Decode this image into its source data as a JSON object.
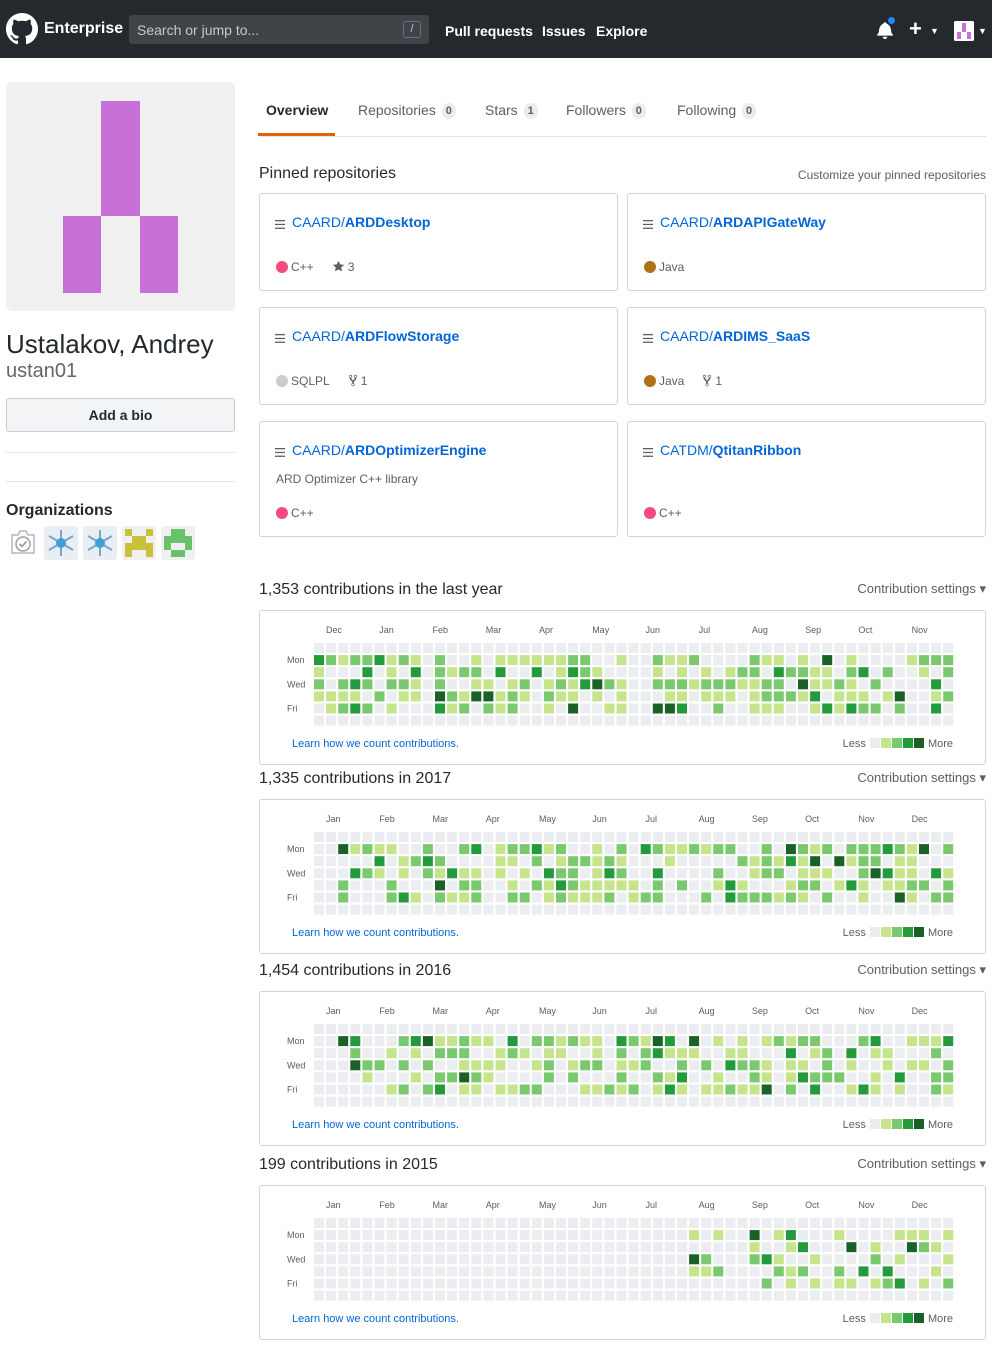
{
  "header": {
    "brand": "Enterprise",
    "search_placeholder": "Search or jump to...",
    "search_key": "/",
    "nav": [
      "Pull requests",
      "Issues",
      "Explore"
    ]
  },
  "profile": {
    "name": "Ustalakov, Andrey",
    "login": "ustan01",
    "bio_button": "Add a bio",
    "orgs_heading": "Organizations"
  },
  "tabs": [
    {
      "label": "Overview",
      "count": ""
    },
    {
      "label": "Repositories",
      "count": "0"
    },
    {
      "label": "Stars",
      "count": "1"
    },
    {
      "label": "Followers",
      "count": "0"
    },
    {
      "label": "Following",
      "count": "0"
    }
  ],
  "pinned": {
    "heading": "Pinned repositories",
    "customize": "Customize your pinned repositories",
    "repos": [
      {
        "owner": "CAARD/",
        "name": "ARDDesktop",
        "desc": "",
        "lang": "C++",
        "lang_color": "#f34b7d",
        "stars": "3",
        "forks": ""
      },
      {
        "owner": "CAARD/",
        "name": "ARDAPIGateWay",
        "desc": "",
        "lang": "Java",
        "lang_color": "#b07219",
        "stars": "",
        "forks": ""
      },
      {
        "owner": "CAARD/",
        "name": "ARDFlowStorage",
        "desc": "",
        "lang": "SQLPL",
        "lang_color": "#cccccc",
        "stars": "",
        "forks": "1"
      },
      {
        "owner": "CAARD/",
        "name": "ARDIMS_SaaS",
        "desc": "",
        "lang": "Java",
        "lang_color": "#b07219",
        "stars": "",
        "forks": "1"
      },
      {
        "owner": "CAARD/",
        "name": "ARDOptimizerEngine",
        "desc": "ARD Optimizer C++ library",
        "lang": "C++",
        "lang_color": "#f34b7d",
        "stars": "",
        "forks": ""
      },
      {
        "owner": "CATDM/",
        "name": "QtitanRibbon",
        "desc": "",
        "lang": "C++",
        "lang_color": "#f34b7d",
        "stars": "",
        "forks": ""
      }
    ]
  },
  "contributions": {
    "settings_label": "Contribution settings",
    "learn": "Learn how we count contributions.",
    "less": "Less",
    "more": "More",
    "days": [
      "Mon",
      "Wed",
      "Fri"
    ],
    "colors": [
      "#ebedf0",
      "#c6e48b",
      "#7bc96f",
      "#239a3b",
      "#196127"
    ],
    "years": [
      {
        "title": "1,353 contributions in the last year",
        "months": [
          "Dec",
          "Jan",
          "Feb",
          "Mar",
          "Apr",
          "May",
          "Jun",
          "Jul",
          "Aug",
          "Sep",
          "Oct",
          "Nov"
        ],
        "first_month_week": 1,
        "active_weeks": [
          [
            0,
            8
          ],
          [
            10,
            25
          ],
          [
            28,
            52
          ]
        ],
        "density": 0.7,
        "seed": 11
      },
      {
        "title": "1,335 contributions in 2017",
        "months": [
          "Jan",
          "Feb",
          "Mar",
          "Apr",
          "May",
          "Jun",
          "Jul",
          "Aug",
          "Sep",
          "Oct",
          "Nov",
          "Dec"
        ],
        "first_month_week": 1,
        "active_weeks": [
          [
            2,
            52
          ]
        ],
        "density": 0.6,
        "seed": 23
      },
      {
        "title": "1,454 contributions in 2016",
        "months": [
          "Jan",
          "Feb",
          "Mar",
          "Apr",
          "May",
          "Jun",
          "Jul",
          "Aug",
          "Sep",
          "Oct",
          "Nov",
          "Dec"
        ],
        "first_month_week": 1,
        "active_weeks": [
          [
            1,
            52
          ]
        ],
        "density": 0.62,
        "seed": 37
      },
      {
        "title": "199 contributions in 2015",
        "months": [
          "Jan",
          "Feb",
          "Mar",
          "Apr",
          "May",
          "Jun",
          "Jul",
          "Aug",
          "Sep",
          "Oct",
          "Nov",
          "Dec"
        ],
        "first_month_week": 1,
        "active_weeks": [
          [
            31,
            33
          ],
          [
            36,
            52
          ]
        ],
        "density": 0.45,
        "seed": 53
      }
    ]
  }
}
